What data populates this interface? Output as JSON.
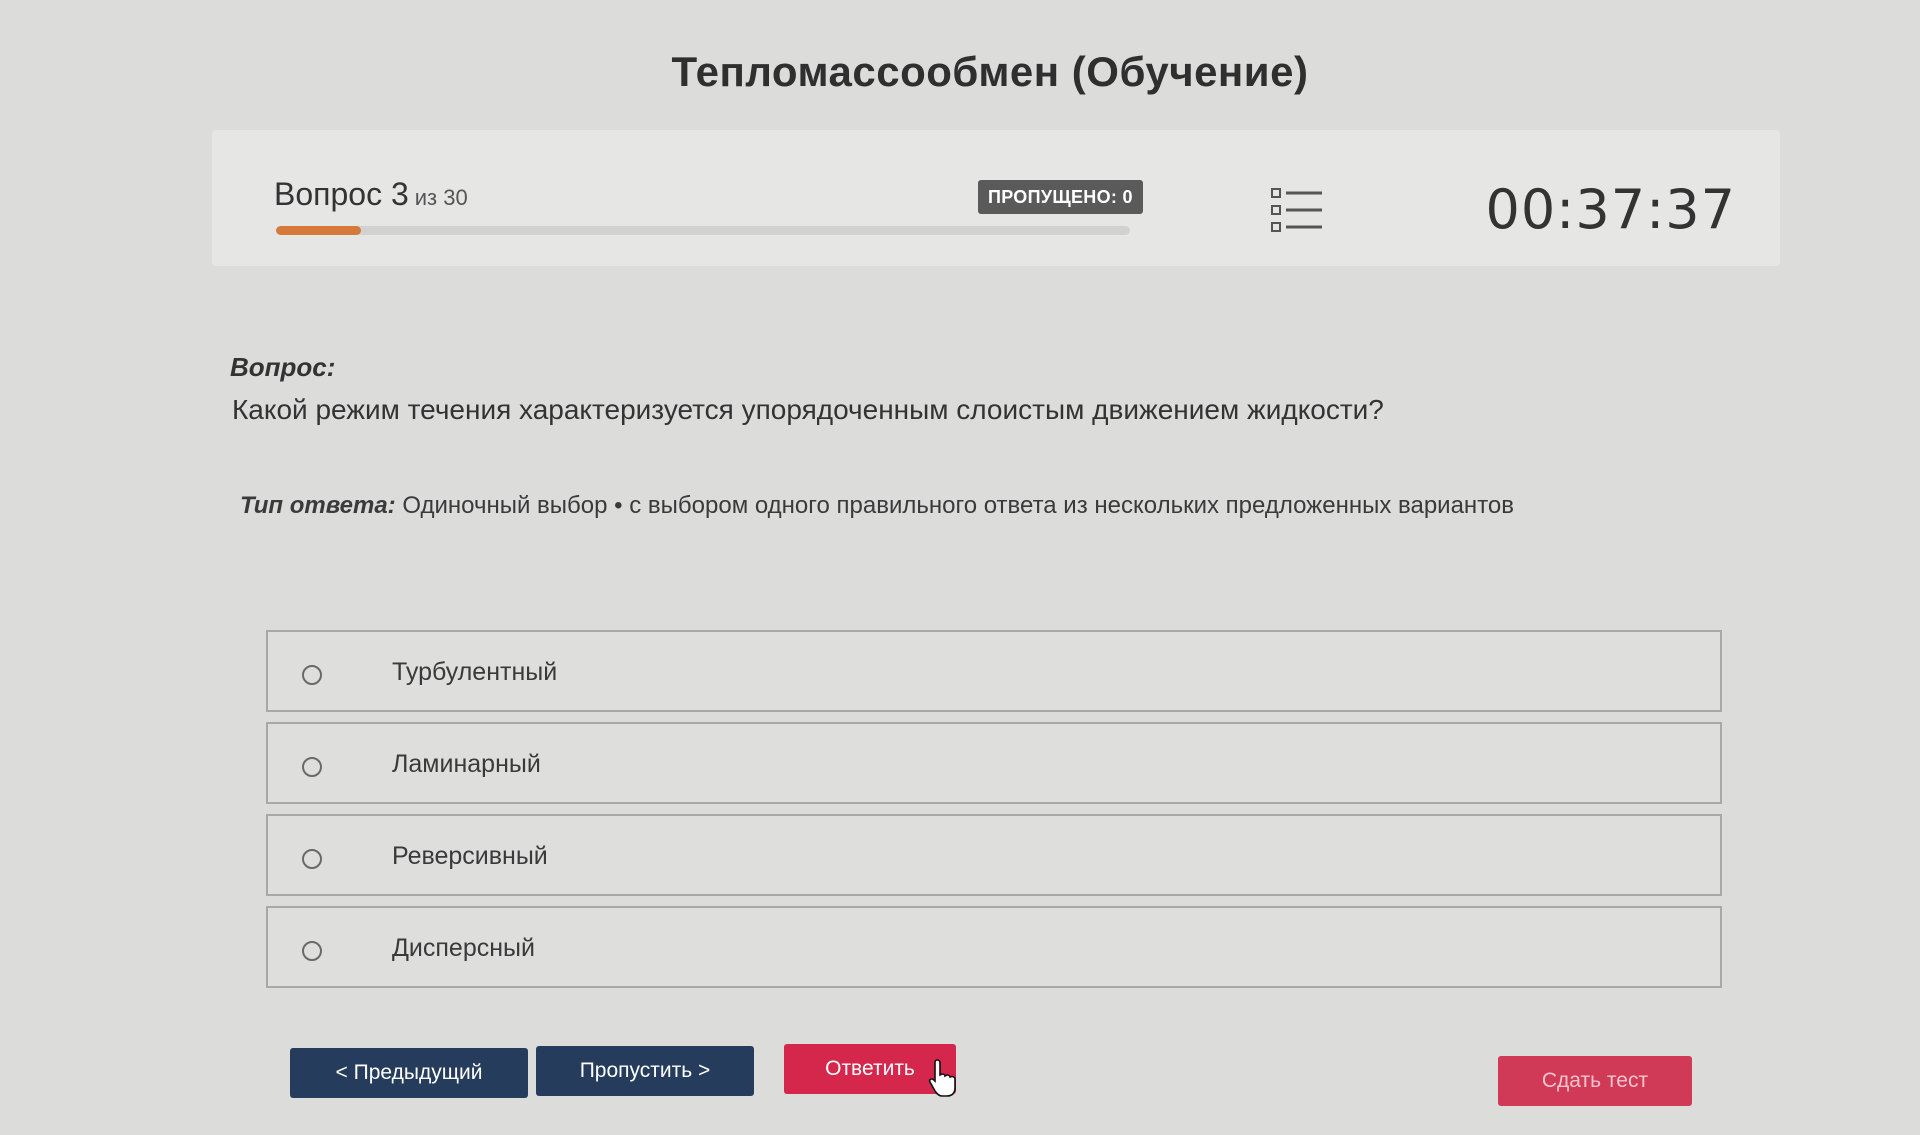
{
  "title": "Тепломассообмен (Обучение)",
  "status": {
    "question_label": "Вопрос 3",
    "question_of": "из 30",
    "progress": 0.1,
    "skipped_badge": "ПРОПУЩЕНО: 0",
    "timer": "00:37:37"
  },
  "question": {
    "label": "Вопрос:",
    "text": "Какой режим течения характеризуется упорядоченным слоистым движением жидкости?"
  },
  "answer_type": {
    "label": "Тип ответа:",
    "value": "Одиночный выбор • с выбором одного правильного ответа из нескольких предложенных вариантов"
  },
  "options": [
    {
      "label": "Турбулентный"
    },
    {
      "label": "Ламинарный"
    },
    {
      "label": "Реверсивный"
    },
    {
      "label": "Дисперсный"
    }
  ],
  "buttons": {
    "prev": "< Предыдущий",
    "skip": "Пропустить >",
    "answer": "Ответить",
    "submit": "Сдать тест"
  },
  "colors": {
    "primary": "#263c5c",
    "accent": "#d5264b",
    "progress": "#d67a3a"
  },
  "icons": {
    "question_list": "list-icon",
    "cursor": "hand-pointer-icon"
  }
}
